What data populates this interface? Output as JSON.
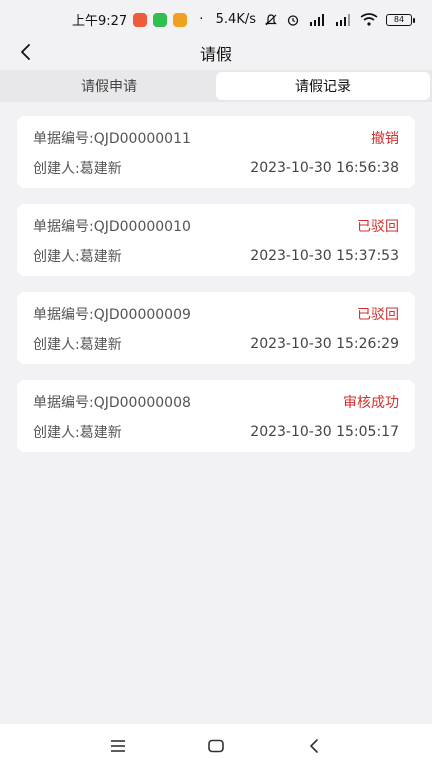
{
  "status_bar": {
    "time": "上午9:27",
    "dot": "·",
    "speed": "5.4K/s",
    "battery": "84"
  },
  "nav": {
    "title": "请假"
  },
  "tabs": [
    {
      "label": "请假申请",
      "active": false
    },
    {
      "label": "请假记录",
      "active": true
    }
  ],
  "records": [
    {
      "doc_no": "单据编号:QJD00000011",
      "creator": "创建人:葛建新",
      "status": "撤销",
      "time": "2023-10-30 16:56:38"
    },
    {
      "doc_no": "单据编号:QJD00000010",
      "creator": "创建人:葛建新",
      "status": "已驳回",
      "time": "2023-10-30 15:37:53"
    },
    {
      "doc_no": "单据编号:QJD00000009",
      "creator": "创建人:葛建新",
      "status": "已驳回",
      "time": "2023-10-30 15:26:29"
    },
    {
      "doc_no": "单据编号:QJD00000008",
      "creator": "创建人:葛建新",
      "status": "审核成功",
      "time": "2023-10-30 15:05:17"
    }
  ],
  "colors": {
    "status_red": "#d32f2f",
    "background": "#f2f2f4"
  }
}
